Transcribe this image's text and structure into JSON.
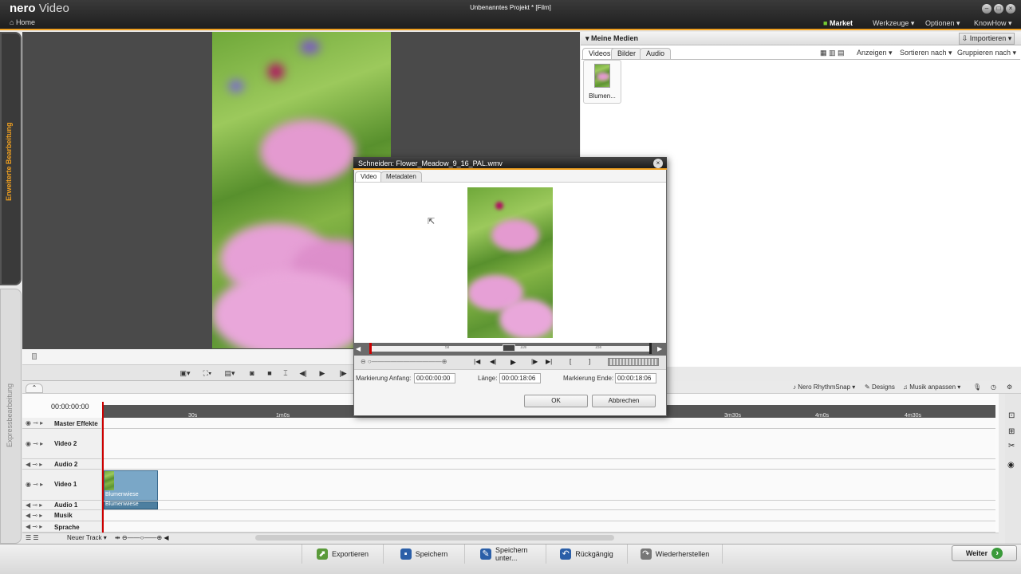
{
  "app": {
    "brand": "nero",
    "product": "Video",
    "home": "Home",
    "window_title": "Unbenanntes Projekt * [Film]",
    "menu": [
      "Market",
      "Werkzeuge ▾",
      "Optionen ▾",
      "KnowHow ▾"
    ]
  },
  "side": {
    "advanced": "Erweiterte Bearbeitung",
    "express": "Expressbearbeitung"
  },
  "media": {
    "title": "▾ Meine Medien",
    "import": "⇩ Importieren ▾",
    "tabs": [
      "Videos",
      "Bilder",
      "Audio"
    ],
    "tools": [
      "Anzeigen ▾",
      "Sortieren nach ▾",
      "Gruppieren nach ▾"
    ],
    "items": [
      {
        "label": "Blumen..."
      }
    ]
  },
  "tl_tools": [
    "Nero RhythmSnap ▾",
    "Designs",
    "Musik anpassen ▾"
  ],
  "timeline": {
    "timecode": "00:00:00:00",
    "ticks": [
      "30s",
      "1m0s",
      "3m30s",
      "4m0s",
      "4m30s"
    ],
    "tracks": [
      {
        "name": "Master Effekte"
      },
      {
        "name": "Video 2"
      },
      {
        "name": "Audio 2"
      },
      {
        "name": "Video 1"
      },
      {
        "name": "Audio 1"
      },
      {
        "name": "Musik"
      },
      {
        "name": "Sprache"
      }
    ],
    "clip_label": "Blumenwiese",
    "new_track": "Neuer Track ▾"
  },
  "bottom": {
    "buttons": [
      "Exportieren",
      "Speichern",
      "Speichern unter...",
      "Rückgängig",
      "Wiederherstellen"
    ],
    "next": "Weiter"
  },
  "dialog": {
    "title": "Schneiden: Flower_Meadow_9_16_PAL.wmv",
    "tabs": [
      "Video",
      "Metadaten"
    ],
    "scrub_ticks": [
      "5s",
      "10s",
      "15s"
    ],
    "mark_start_label": "Markierung Anfang:",
    "mark_start_value": "00:00:00:00",
    "length_label": "Länge:",
    "length_value": "00:00:18:06",
    "mark_end_label": "Markierung Ende:",
    "mark_end_value": "00:00:18:06",
    "ok": "OK",
    "cancel": "Abbrechen"
  },
  "colors": {
    "accent": "#f0a020",
    "clip": "#7aa7c7",
    "playhead": "#cc0000"
  }
}
